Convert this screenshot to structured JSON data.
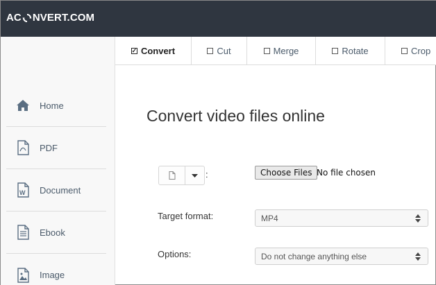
{
  "header": {
    "logo_prefix": "AC",
    "logo_suffix": "NVERT.COM"
  },
  "sidebar": {
    "items": [
      {
        "label": "Home",
        "icon": "home-icon"
      },
      {
        "label": "PDF",
        "icon": "pdf-icon"
      },
      {
        "label": "Document",
        "icon": "document-icon"
      },
      {
        "label": "Ebook",
        "icon": "ebook-icon"
      },
      {
        "label": "Image",
        "icon": "image-icon"
      }
    ]
  },
  "tabs": [
    {
      "label": "Convert",
      "active": true
    },
    {
      "label": "Cut",
      "active": false
    },
    {
      "label": "Merge",
      "active": false
    },
    {
      "label": "Rotate",
      "active": false
    },
    {
      "label": "Crop",
      "active": false
    }
  ],
  "main": {
    "heading": "Convert video files online",
    "file_source_colon": ":",
    "choose_files_label": "Choose Files",
    "no_file_text": "No file chosen",
    "target_format_label": "Target format:",
    "target_format_value": "MP4",
    "options_label": "Options:",
    "options_value": "Do not change anything else"
  },
  "colors": {
    "topbar": "#2f3640",
    "sidebar_text": "#4a5a6a",
    "icon": "#5a6e82"
  }
}
